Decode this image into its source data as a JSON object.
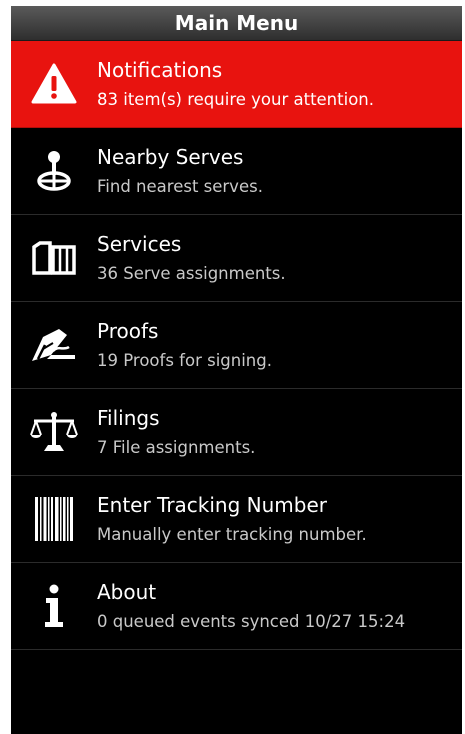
{
  "header": {
    "title": "Main Menu"
  },
  "menu": {
    "items": [
      {
        "title": "Notifications",
        "subtitle": "83 item(s) require your attention.",
        "icon": "warning-icon",
        "highlight_color": "#e8130f"
      },
      {
        "title": "Nearby Serves",
        "subtitle": "Find nearest serves.",
        "icon": "map-pin-icon"
      },
      {
        "title": "Services",
        "subtitle": "36 Serve assignments.",
        "icon": "documents-icon"
      },
      {
        "title": "Proofs",
        "subtitle": "19 Proofs for signing.",
        "icon": "pen-signature-icon"
      },
      {
        "title": "Filings",
        "subtitle": "7 File assignments.",
        "icon": "scales-icon"
      },
      {
        "title": "Enter Tracking Number",
        "subtitle": "Manually enter tracking number.",
        "icon": "barcode-icon"
      },
      {
        "title": "About",
        "subtitle": "0 queued events synced 10/27 15:24",
        "icon": "info-icon"
      }
    ]
  },
  "colors": {
    "background": "#000000",
    "alert": "#e8130f",
    "text": "#ffffff",
    "subtext": "#c9c9c9"
  }
}
